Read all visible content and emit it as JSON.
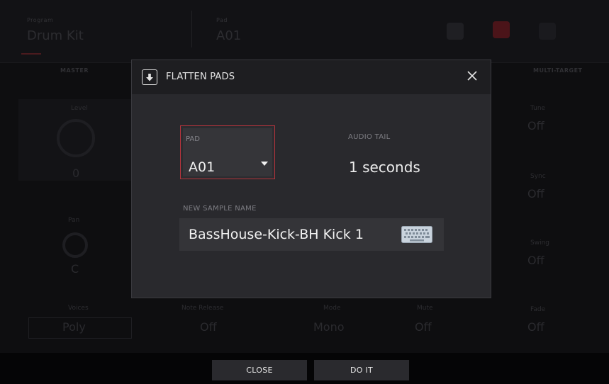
{
  "background": {
    "header": {
      "left_label": "Program",
      "left_value": "Drum Kit",
      "right_label": "Pad",
      "right_value": "A01"
    },
    "tabs": [
      "MASTER",
      "MULTI-TARGET"
    ],
    "controls": [
      {
        "label": "Level",
        "value": "0"
      },
      {
        "label": "Pan",
        "value": "C"
      },
      {
        "label": "Voices",
        "value": "Poly"
      },
      {
        "label": "Note Release",
        "value": "Off"
      },
      {
        "label": "Mode",
        "value": "Mono"
      },
      {
        "label": "Mute",
        "value": "Off"
      },
      {
        "label": "Tune",
        "value": "Off"
      },
      {
        "label": "Sync",
        "value": "Off"
      },
      {
        "label": "Swing",
        "value": "Off"
      },
      {
        "label": "Fade",
        "value": "Off"
      }
    ]
  },
  "modal": {
    "title": "FLATTEN PADS",
    "icon": "flatten-download-icon",
    "close_icon": "close-icon",
    "pad": {
      "label": "PAD",
      "value": "A01"
    },
    "audio_tail": {
      "label": "AUDIO TAIL",
      "value": "1 seconds"
    },
    "sample_name": {
      "label": "NEW SAMPLE NAME",
      "value": "BassHouse-Kick-BH Kick 1"
    },
    "keyboard_icon": "keyboard-icon"
  },
  "footer": {
    "close_label": "CLOSE",
    "doit_label": "DO IT"
  },
  "colors": {
    "accent": "#b4343c",
    "modal_bg": "#29292d",
    "modal_header_bg": "#1e1e21",
    "field_bg": "#343438"
  }
}
